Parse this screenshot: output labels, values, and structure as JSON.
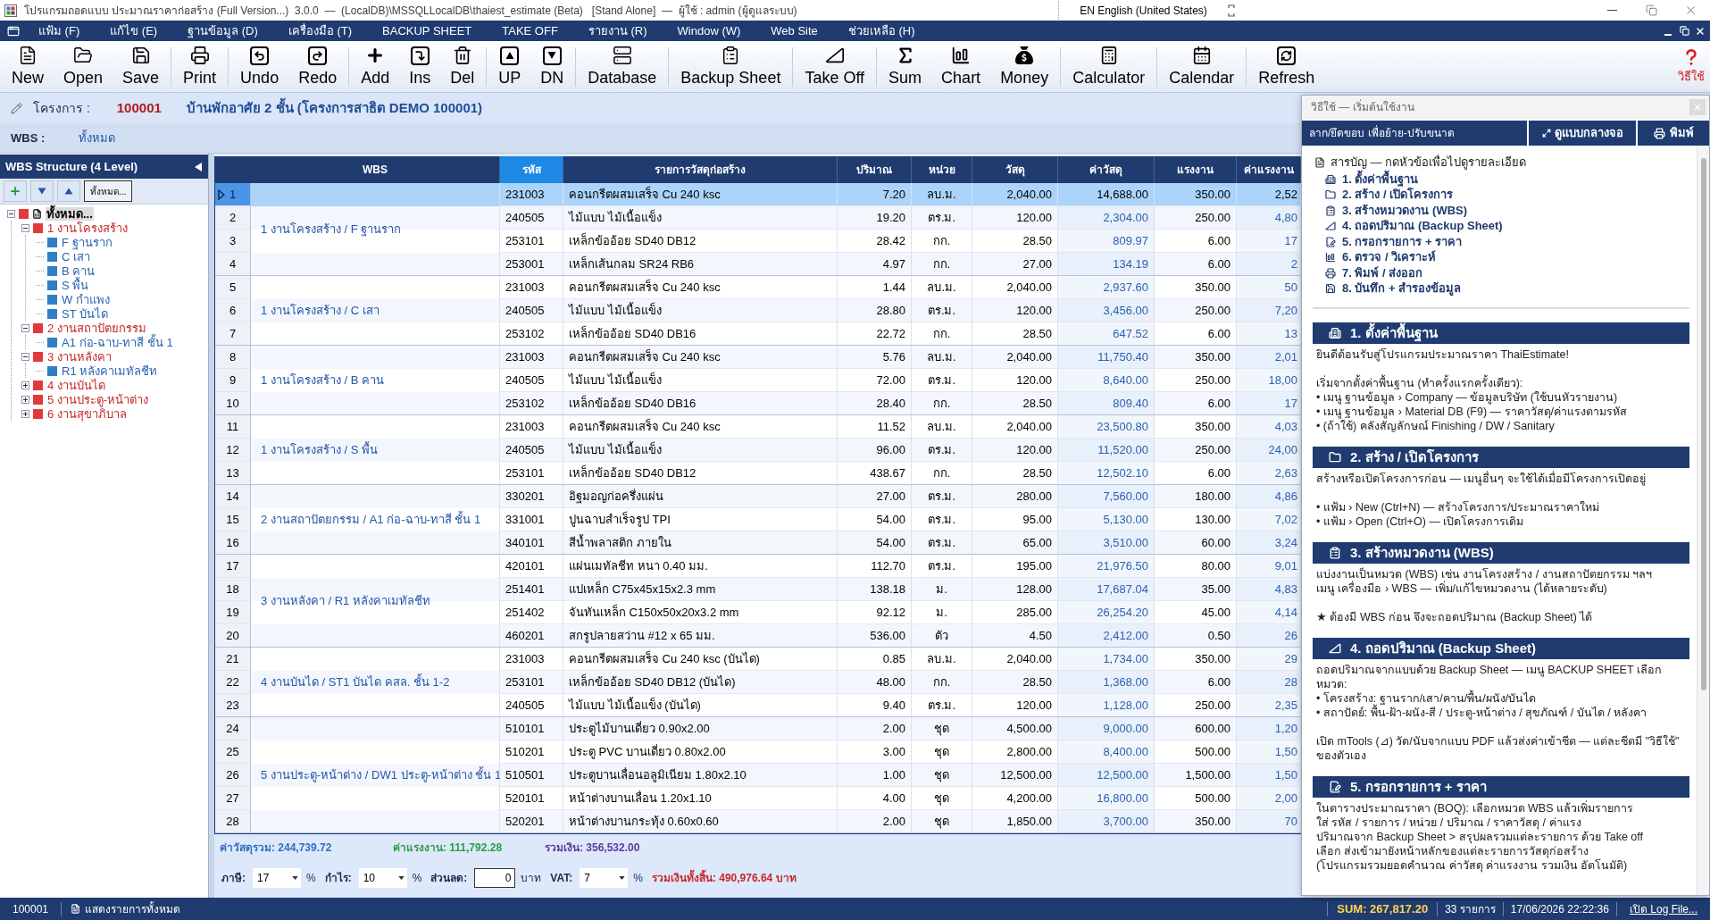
{
  "window": {
    "title": "โปรแกรมถอดแบบ ประมาณราคาก่อสร้าง (Full Version...)  3.0.0  —  (LocalDB)\\MSSQLLocalDB\\thaiest_estimate (Beta)   [Stand Alone]  —  ผู้ใช้ : admin (ผู้ดูแลระบบ)",
    "input_language": "EN English (United States)"
  },
  "menu": [
    "แฟ้ม (F)",
    "แก้ไข (E)",
    "ฐานข้อมูล (D)",
    "เครื่องมือ (T)",
    "BACKUP SHEET",
    "TAKE OFF",
    "รายงาน (R)",
    "Window (W)",
    "Web Site",
    "ช่วยเหลือ (H)"
  ],
  "toolbar": {
    "groups": [
      [
        "New",
        "Open",
        "Save"
      ],
      [
        "Print"
      ],
      [
        "Undo",
        "Redo"
      ],
      [
        "Add",
        "Ins",
        "Del"
      ],
      [
        "UP",
        "DN"
      ],
      [
        "Database"
      ],
      [
        "Backup Sheet"
      ],
      [
        "Take Off"
      ],
      [
        "Sum",
        "Chart",
        "Money"
      ],
      [
        "Calculator"
      ],
      [
        "Calendar"
      ],
      [
        "Refresh"
      ]
    ],
    "help": "วิธีใช้"
  },
  "project": {
    "label": "โครงการ :",
    "code": "100001",
    "name": "บ้านพักอาศัย 2 ชั้น (โครงการสาธิต DEMO 100001)"
  },
  "wbs_filter": {
    "label": "WBS :",
    "value": "ทั้งหมด"
  },
  "wbs_panel": {
    "title": "WBS Structure (4 Level)",
    "show_all_button": "ทั้งหมด...",
    "tree": [
      {
        "label": "ทั้งหมด...",
        "expanded": true,
        "selected": true,
        "children": [
          {
            "label": "1 งานโครงสร้าง",
            "expanded": true,
            "selected": false,
            "children": [
              {
                "label": "F ฐานราก",
                "selected": false
              },
              {
                "label": "C เสา",
                "selected": false
              },
              {
                "label": "B คาน",
                "selected": false
              },
              {
                "label": "S พื้น",
                "selected": false
              },
              {
                "label": "W กำแพง",
                "selected": false
              },
              {
                "label": "ST บันได",
                "selected": false
              }
            ]
          },
          {
            "label": "2 งานสถาปัตยกรรม",
            "expanded": true,
            "selected": false,
            "children": [
              {
                "label": "A1 ก่อ-ฉาบ-ทาสี ชั้น 1",
                "selected": false
              }
            ]
          },
          {
            "label": "3 งานหลังคา",
            "expanded": true,
            "selected": false,
            "children": [
              {
                "label": "R1 หลังคาเมทัลชีท",
                "selected": false
              }
            ]
          },
          {
            "label": "4 งานบันได",
            "expanded": false,
            "selected": false
          },
          {
            "label": "5 งานประตู-หน้าต่าง",
            "expanded": false,
            "selected": false
          },
          {
            "label": "6 งานสุขาภิบาล",
            "expanded": false,
            "selected": false
          }
        ]
      }
    ]
  },
  "table": {
    "columns": [
      {
        "label": "WBS",
        "highlighted": false
      },
      {
        "label": "รหัส",
        "highlighted": true
      },
      {
        "label": "รายการวัสดุก่อสร้าง",
        "highlighted": false
      },
      {
        "label": "ปริมาณ",
        "highlighted": false
      },
      {
        "label": "หน่วย",
        "highlighted": false
      },
      {
        "label": "วัสดุ",
        "highlighted": false
      },
      {
        "label": "ค่าวัสดุ",
        "highlighted": false
      },
      {
        "label": "แรงงาน",
        "highlighted": false
      },
      {
        "label": "ค่าแรงงาน",
        "highlighted": false
      }
    ],
    "groups": [
      {
        "wbs": "1 งานโครงสร้าง / F ฐานราก",
        "rows": [
          {
            "no": "1",
            "code": "231003",
            "item": "คอนกรีตผสมเสร็จ Cu 240 ksc",
            "qty": "7.20",
            "unit": "ลบ.ม.",
            "mat_price": "2,040.00",
            "mat_cost": "14,688.00",
            "lab_price": "350.00",
            "lab_cost": "2,52",
            "selected": true
          },
          {
            "no": "2",
            "code": "240505",
            "item": "ไม้แบบ ไม้เนื้อแข็ง",
            "qty": "19.20",
            "unit": "ตร.ม.",
            "mat_price": "120.00",
            "mat_cost": "2,304.00",
            "lab_price": "250.00",
            "lab_cost": "4,80",
            "selected": false
          },
          {
            "no": "3",
            "code": "253101",
            "item": "เหล็กข้ออ้อย SD40 DB12",
            "qty": "28.42",
            "unit": "กก.",
            "mat_price": "28.50",
            "mat_cost": "809.97",
            "lab_price": "6.00",
            "lab_cost": "17",
            "selected": false
          },
          {
            "no": "4",
            "code": "253001",
            "item": "เหล็กเส้นกลม SR24 RB6",
            "qty": "4.97",
            "unit": "กก.",
            "mat_price": "27.00",
            "mat_cost": "134.19",
            "lab_price": "6.00",
            "lab_cost": "2",
            "selected": false
          }
        ]
      },
      {
        "wbs": "1 งานโครงสร้าง / C เสา",
        "rows": [
          {
            "no": "5",
            "code": "231003",
            "item": "คอนกรีตผสมเสร็จ Cu 240 ksc",
            "qty": "1.44",
            "unit": "ลบ.ม.",
            "mat_price": "2,040.00",
            "mat_cost": "2,937.60",
            "lab_price": "350.00",
            "lab_cost": "50",
            "selected": false
          },
          {
            "no": "6",
            "code": "240505",
            "item": "ไม้แบบ ไม้เนื้อแข็ง",
            "qty": "28.80",
            "unit": "ตร.ม.",
            "mat_price": "120.00",
            "mat_cost": "3,456.00",
            "lab_price": "250.00",
            "lab_cost": "7,20",
            "selected": false
          },
          {
            "no": "7",
            "code": "253102",
            "item": "เหล็กข้ออ้อย SD40 DB16",
            "qty": "22.72",
            "unit": "กก.",
            "mat_price": "28.50",
            "mat_cost": "647.52",
            "lab_price": "6.00",
            "lab_cost": "13",
            "selected": false
          }
        ]
      },
      {
        "wbs": "1 งานโครงสร้าง / B คาน",
        "rows": [
          {
            "no": "8",
            "code": "231003",
            "item": "คอนกรีตผสมเสร็จ Cu 240 ksc",
            "qty": "5.76",
            "unit": "ลบ.ม.",
            "mat_price": "2,040.00",
            "mat_cost": "11,750.40",
            "lab_price": "350.00",
            "lab_cost": "2,01",
            "selected": false
          },
          {
            "no": "9",
            "code": "240505",
            "item": "ไม้แบบ ไม้เนื้อแข็ง",
            "qty": "72.00",
            "unit": "ตร.ม.",
            "mat_price": "120.00",
            "mat_cost": "8,640.00",
            "lab_price": "250.00",
            "lab_cost": "18,00",
            "selected": false
          },
          {
            "no": "10",
            "code": "253102",
            "item": "เหล็กข้ออ้อย SD40 DB16",
            "qty": "28.40",
            "unit": "กก.",
            "mat_price": "28.50",
            "mat_cost": "809.40",
            "lab_price": "6.00",
            "lab_cost": "17",
            "selected": false
          }
        ]
      },
      {
        "wbs": "1 งานโครงสร้าง / S พื้น",
        "rows": [
          {
            "no": "11",
            "code": "231003",
            "item": "คอนกรีตผสมเสร็จ Cu 240 ksc",
            "qty": "11.52",
            "unit": "ลบ.ม.",
            "mat_price": "2,040.00",
            "mat_cost": "23,500.80",
            "lab_price": "350.00",
            "lab_cost": "4,03",
            "selected": false
          },
          {
            "no": "12",
            "code": "240505",
            "item": "ไม้แบบ ไม้เนื้อแข็ง",
            "qty": "96.00",
            "unit": "ตร.ม.",
            "mat_price": "120.00",
            "mat_cost": "11,520.00",
            "lab_price": "250.00",
            "lab_cost": "24,00",
            "selected": false
          },
          {
            "no": "13",
            "code": "253101",
            "item": "เหล็กข้ออ้อย SD40 DB12",
            "qty": "438.67",
            "unit": "กก.",
            "mat_price": "28.50",
            "mat_cost": "12,502.10",
            "lab_price": "6.00",
            "lab_cost": "2,63",
            "selected": false
          }
        ]
      },
      {
        "wbs": "2 งานสถาปัตยกรรม / A1 ก่อ-ฉาบ-ทาสี ชั้น 1",
        "rows": [
          {
            "no": "14",
            "code": "330201",
            "item": "อิฐมอญก่อครึ่งแผ่น",
            "qty": "27.00",
            "unit": "ตร.ม.",
            "mat_price": "280.00",
            "mat_cost": "7,560.00",
            "lab_price": "180.00",
            "lab_cost": "4,86",
            "selected": false
          },
          {
            "no": "15",
            "code": "331001",
            "item": "ปูนฉาบสำเร็จรูป TPI",
            "qty": "54.00",
            "unit": "ตร.ม.",
            "mat_price": "95.00",
            "mat_cost": "5,130.00",
            "lab_price": "130.00",
            "lab_cost": "7,02",
            "selected": false
          },
          {
            "no": "16",
            "code": "340101",
            "item": "สีน้ำพลาสติก ภายใน",
            "qty": "54.00",
            "unit": "ตร.ม.",
            "mat_price": "65.00",
            "mat_cost": "3,510.00",
            "lab_price": "60.00",
            "lab_cost": "3,24",
            "selected": false
          }
        ]
      },
      {
        "wbs": "3 งานหลังคา / R1 หลังคาเมทัลชีท",
        "rows": [
          {
            "no": "17",
            "code": "420101",
            "item": "แผ่นเมทัลชีท หนา 0.40 มม.",
            "qty": "112.70",
            "unit": "ตร.ม.",
            "mat_price": "195.00",
            "mat_cost": "21,976.50",
            "lab_price": "80.00",
            "lab_cost": "9,01",
            "selected": false
          },
          {
            "no": "18",
            "code": "251401",
            "item": "แปเหล็ก C75x45x15x2.3 mm",
            "qty": "138.18",
            "unit": "ม.",
            "mat_price": "128.00",
            "mat_cost": "17,687.04",
            "lab_price": "35.00",
            "lab_cost": "4,83",
            "selected": false
          },
          {
            "no": "19",
            "code": "251402",
            "item": "จันทันเหล็ก C150x50x20x3.2 mm",
            "qty": "92.12",
            "unit": "ม.",
            "mat_price": "285.00",
            "mat_cost": "26,254.20",
            "lab_price": "45.00",
            "lab_cost": "4,14",
            "selected": false
          },
          {
            "no": "20",
            "code": "460201",
            "item": "สกรูปลายสว่าน #12 x 65 มม.",
            "qty": "536.00",
            "unit": "ตัว",
            "mat_price": "4.50",
            "mat_cost": "2,412.00",
            "lab_price": "0.50",
            "lab_cost": "26",
            "selected": false
          }
        ]
      },
      {
        "wbs": "4 งานบันได / ST1 บันได คสล. ชั้น 1-2",
        "rows": [
          {
            "no": "21",
            "code": "231003",
            "item": "คอนกรีตผสมเสร็จ Cu 240 ksc (บันได)",
            "qty": "0.85",
            "unit": "ลบ.ม.",
            "mat_price": "2,040.00",
            "mat_cost": "1,734.00",
            "lab_price": "350.00",
            "lab_cost": "29",
            "selected": false
          },
          {
            "no": "22",
            "code": "253101",
            "item": "เหล็กข้ออ้อย SD40 DB12 (บันได)",
            "qty": "48.00",
            "unit": "กก.",
            "mat_price": "28.50",
            "mat_cost": "1,368.00",
            "lab_price": "6.00",
            "lab_cost": "28",
            "selected": false
          },
          {
            "no": "23",
            "code": "240505",
            "item": "ไม้แบบ ไม้เนื้อแข็ง (บันได)",
            "qty": "9.40",
            "unit": "ตร.ม.",
            "mat_price": "120.00",
            "mat_cost": "1,128.00",
            "lab_price": "250.00",
            "lab_cost": "2,35",
            "selected": false
          }
        ]
      },
      {
        "wbs": "5 งานประตู-หน้าต่าง / DW1 ประตู-หน้าต่าง ชั้น 1",
        "rows": [
          {
            "no": "24",
            "code": "510101",
            "item": "ประตูไม้บานเดี่ยว 0.90x2.00",
            "qty": "2.00",
            "unit": "ชุด",
            "mat_price": "4,500.00",
            "mat_cost": "9,000.00",
            "lab_price": "600.00",
            "lab_cost": "1,20",
            "selected": false
          },
          {
            "no": "25",
            "code": "510201",
            "item": "ประตู PVC บานเดี่ยว 0.80x2.00",
            "qty": "3.00",
            "unit": "ชุด",
            "mat_price": "2,800.00",
            "mat_cost": "8,400.00",
            "lab_price": "500.00",
            "lab_cost": "1,50",
            "selected": false
          },
          {
            "no": "26",
            "code": "510501",
            "item": "ประตูบานเลื่อนอลูมิเนียม 1.80x2.10",
            "qty": "1.00",
            "unit": "ชุด",
            "mat_price": "12,500.00",
            "mat_cost": "12,500.00",
            "lab_price": "1,500.00",
            "lab_cost": "1,50",
            "selected": false
          },
          {
            "no": "27",
            "code": "520101",
            "item": "หน้าต่างบานเลื่อน 1.20x1.10",
            "qty": "4.00",
            "unit": "ชุด",
            "mat_price": "4,200.00",
            "mat_cost": "16,800.00",
            "lab_price": "500.00",
            "lab_cost": "2,00",
            "selected": false
          },
          {
            "no": "28",
            "code": "520201",
            "item": "หน้าต่างบานกระทุ้ง 0.60x0.60",
            "qty": "2.00",
            "unit": "ชุด",
            "mat_price": "1,850.00",
            "mat_cost": "3,700.00",
            "lab_price": "350.00",
            "lab_cost": "70",
            "selected": false
          }
        ]
      }
    ]
  },
  "totals": {
    "sums": [
      {
        "text": "ค่าวัสดุรวม: 244,739.72",
        "color": "#2f6fc4"
      },
      {
        "text": "ค่าแรงงาน: 111,792.28",
        "color": "#2e9b48"
      },
      {
        "text": "รวมเงิน: 356,532.00",
        "color": "#5b3a9c"
      }
    ],
    "adjustments": [
      {
        "kind": "select",
        "label": "ภาษี:",
        "value": "17",
        "unit": "%"
      },
      {
        "kind": "select",
        "label": "กำไร:",
        "value": "10",
        "unit": "%"
      },
      {
        "kind": "input",
        "label": "ส่วนลด:",
        "value": "0",
        "unit": "บาท"
      },
      {
        "kind": "select",
        "label": "VAT:",
        "value": "7",
        "unit": "%"
      }
    ],
    "grand_total": "รวมเงินทั้งสิ้น: 490,976.64 บาท"
  },
  "status_bar": {
    "project_code": "100001",
    "filter": "แสดงรายการทั้งหมด",
    "sum": "SUM: 267,817.20",
    "count": "33 รายการ",
    "datetime": "17/06/2026 22:22:36",
    "log_link": "เปิด Log File..."
  },
  "help_window": {
    "title": "วิธีใช้ — เริ่มต้นใช้งาน",
    "hint": "ลาก/ยึดขอบ เพื่อย้าย-ปรับขนาด",
    "center_button": "ดูแบบกลางจอ",
    "print_button": "พิมพ์",
    "toc_title": "สารบัญ — กดหัวข้อเพื่อไปดูรายละเอียด",
    "toc": [
      "1. ตั้งค่าพื้นฐาน",
      "2. สร้าง / เปิดโครงการ",
      "3. สร้างหมวดงาน (WBS)",
      "4. ถอดปริมาณ (Backup Sheet)",
      "5. กรอกรายการ + ราคา",
      "6. ตรวจ / วิเคราะห์",
      "7. พิมพ์ / ส่งออก",
      "8. บันทึก + สำรองข้อมูล"
    ],
    "sections": [
      {
        "title": "1. ตั้งค่าพื้นฐาน",
        "blocks": [
          [
            "ยินดีต้อนรับสู่โปรแกรมประมาณราคา ThaiEstimate!"
          ],
          [
            "เริ่มจากตั้งค่าพื้นฐาน (ทำครั้งแรกครั้งเดียว):",
            "• เมนู ฐานข้อมูล › Company — ข้อมูลบริษัท (ใช้บนหัวรายงาน)",
            "• เมนู ฐานข้อมูล › Material DB (F9) — ราคาวัสดุ/ค่าแรงตามรหัส",
            "• (ถ้าใช้) คลังสัญลักษณ์ Finishing / DW / Sanitary"
          ]
        ]
      },
      {
        "title": "2. สร้าง / เปิดโครงการ",
        "blocks": [
          [
            "สร้างหรือเปิดโครงการก่อน — เมนูอื่นๆ จะใช้ได้เมื่อมีโครงการเปิดอยู่"
          ],
          [
            "• แฟ้ม › New (Ctrl+N) — สร้างโครงการ/ประมาณราคาใหม่",
            "• แฟ้ม › Open (Ctrl+O) — เปิดโครงการเดิม"
          ]
        ]
      },
      {
        "title": "3. สร้างหมวดงาน (WBS)",
        "blocks": [
          [
            "แบ่งงานเป็นหมวด (WBS) เช่น งานโครงสร้าง / งานสถาปัตยกรรม ฯลฯ",
            "เมนู เครื่องมือ › WBS — เพิ่ม/แก้ไขหมวดงาน (ได้หลายระดับ)"
          ],
          [
            "★ ต้องมี WBS ก่อน จึงจะถอดปริมาณ (Backup Sheet) ได้"
          ]
        ]
      },
      {
        "title": "4. ถอดปริมาณ (Backup Sheet)",
        "blocks": [
          [
            "ถอดปริมาณจากแบบด้วย Backup Sheet — เมนู BACKUP SHEET เลือกหมวด:",
            "• โครงสร้าง: ฐานราก/เสา/คาน/พื้น/ผนัง/บันได",
            "• สถาปัตย์: พื้น-ฝ้า-ผนัง-สี / ประตู-หน้าต่าง / สุขภัณฑ์ / บันได / หลังคา"
          ],
          [
            "เปิด mTools (⊿) วัด/นับจากแบบ PDF แล้วส่งค่าเข้าชีต — แต่ละชีตมี \"วิธีใช้\" ของตัวเอง"
          ]
        ]
      },
      {
        "title": "5. กรอกรายการ + ราคา",
        "blocks": [
          [
            "ในตารางประมาณราคา (BOQ): เลือกหมวด WBS แล้วเพิ่มรายการ",
            "ใส่ รหัส / รายการ / หน่วย / ปริมาณ / ราคาวัสดุ / ค่าแรง",
            "ปริมาณจาก Backup Sheet > สรุปผลรวมแต่ละรายการ ด้วย Take off",
            "เลือก ส่งเข้ามายังหน้าหลักของแต่ละรายการวัสดุก่อสร้าง",
            "(โปรแกรมรวมยอดคำนวณ ค่าวัสดุ ค่าแรงงาน รวมเงิน อัตโนมัติ)"
          ]
        ]
      }
    ]
  }
}
